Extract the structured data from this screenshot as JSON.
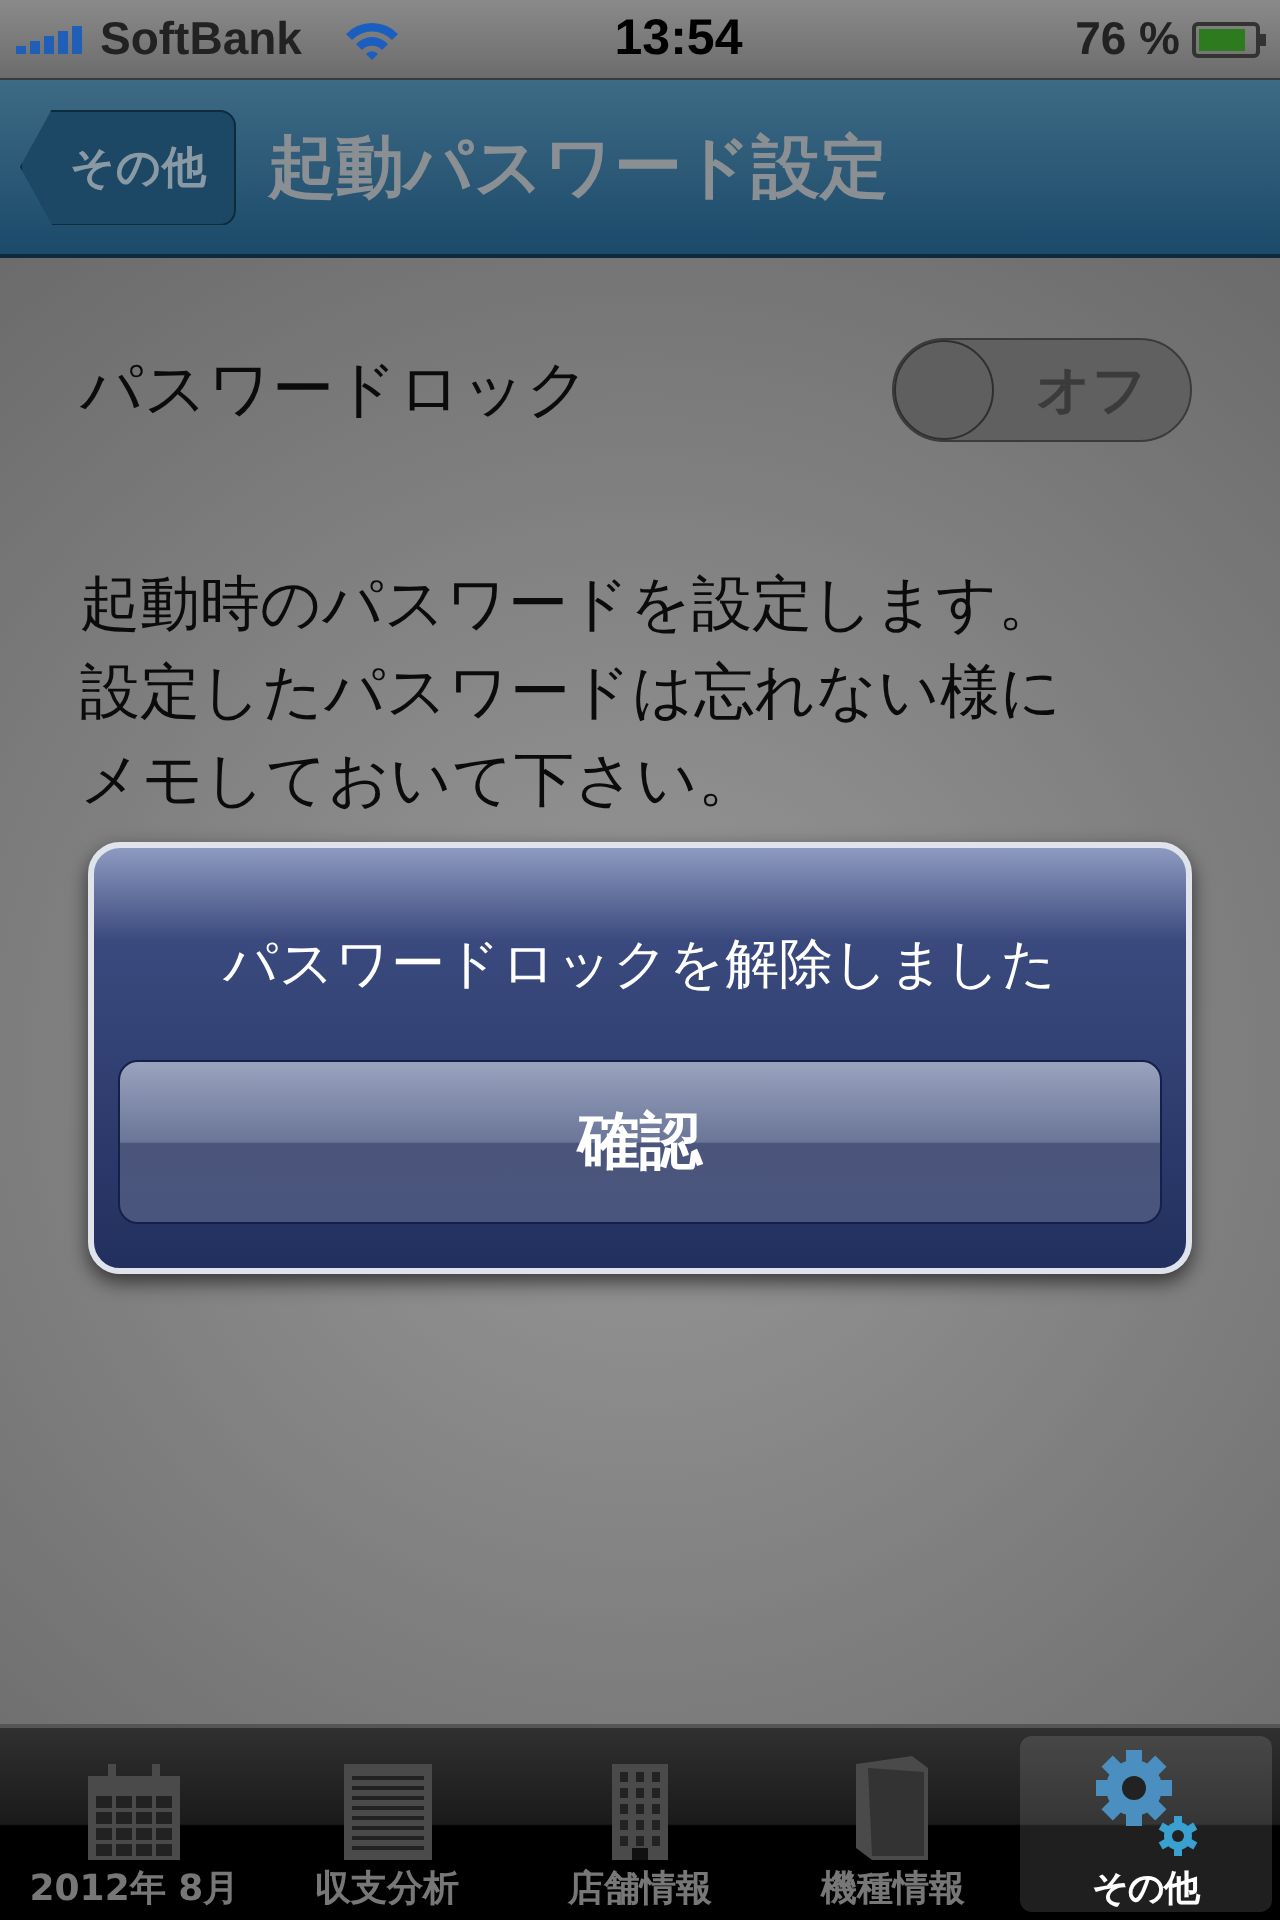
{
  "status_bar": {
    "carrier": "SoftBank",
    "time": "13:54",
    "battery": "76 %"
  },
  "nav_bar": {
    "back": "その他",
    "title": "起動パスワード設定"
  },
  "setting": {
    "label": "パスワードロック",
    "on": false,
    "toggle_label": "オフ"
  },
  "description": [
    "起動時のパスワードを設定します。",
    "設定したパスワードは忘れない様に",
    "メモしておいて下さい。"
  ],
  "alert": {
    "message": "パスワードロックを解除しました",
    "button": "確認"
  },
  "tabs": [
    {
      "label": "2012年 8月",
      "kind": "calendar",
      "selected": false
    },
    {
      "label": "収支分析",
      "kind": "notepad",
      "selected": false
    },
    {
      "label": "店舗情報",
      "kind": "building",
      "selected": false
    },
    {
      "label": "機種情報",
      "kind": "book",
      "selected": false
    },
    {
      "label": "その他",
      "kind": "gears",
      "selected": true
    }
  ]
}
